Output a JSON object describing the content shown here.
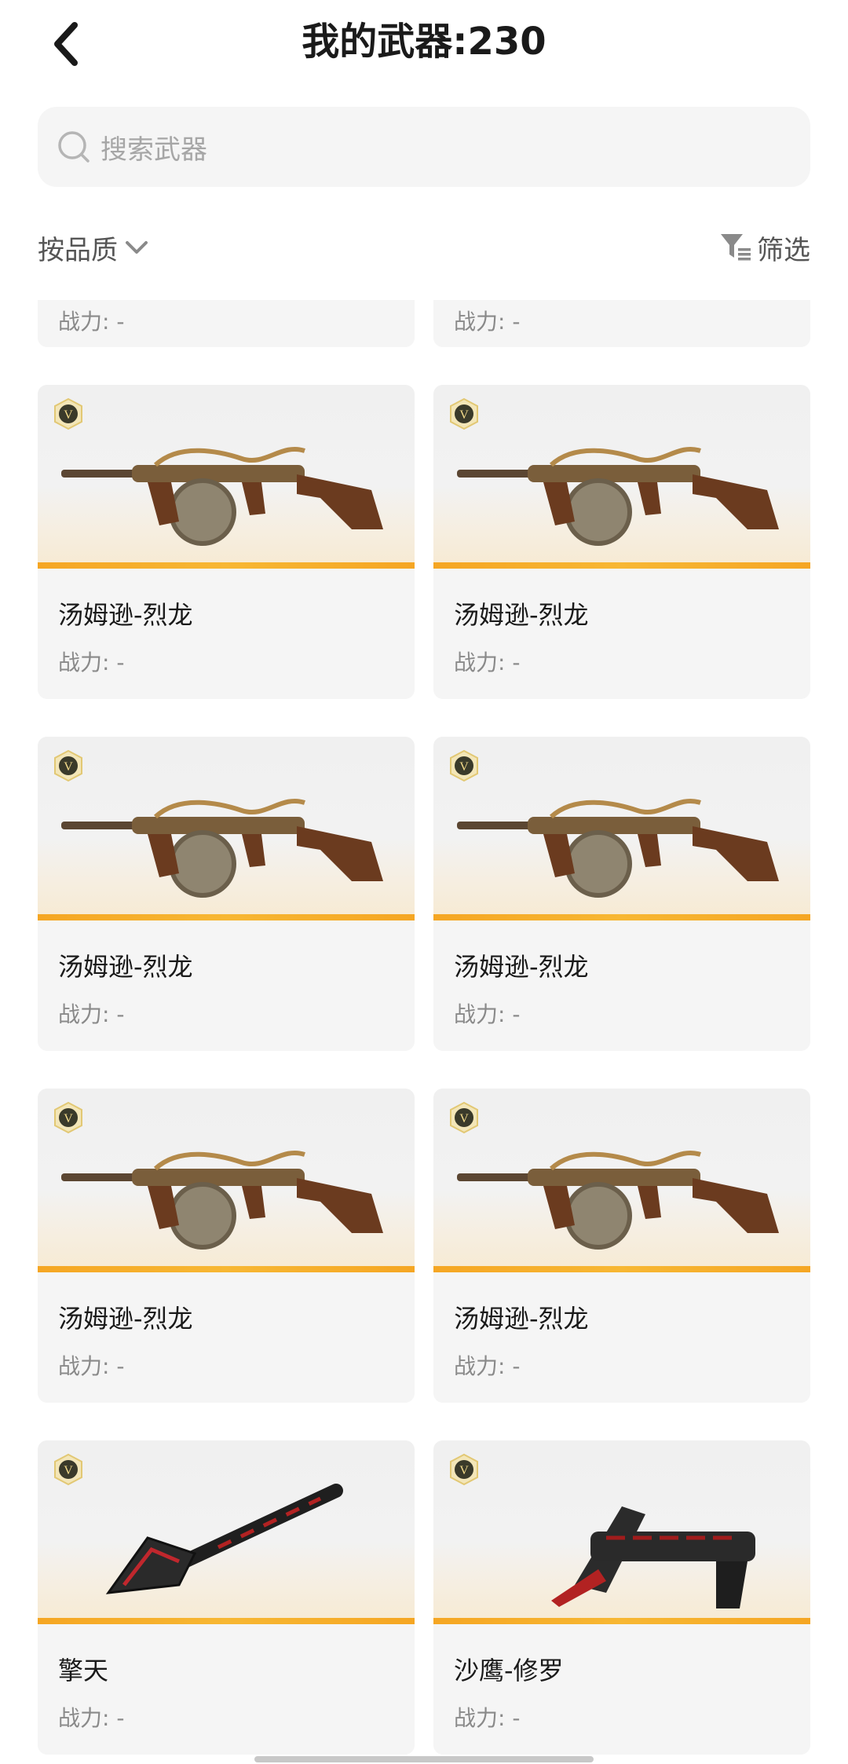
{
  "header": {
    "title": "我的武器:230"
  },
  "search": {
    "placeholder": "搜索武器"
  },
  "sort": {
    "label": "按品质"
  },
  "filter": {
    "label": "筛选"
  },
  "colors": {
    "accent": "#f5a623",
    "card_bg": "#f5f5f5",
    "muted": "#8a8a8a"
  },
  "weapons": [
    {
      "name": "",
      "power": "战力: -",
      "icon": "weapon-icon"
    },
    {
      "name": "",
      "power": "战力: -",
      "icon": "weapon-icon"
    },
    {
      "name": "汤姆逊-烈龙",
      "power": "战力: -",
      "icon": "smg-icon"
    },
    {
      "name": "汤姆逊-烈龙",
      "power": "战力: -",
      "icon": "smg-icon"
    },
    {
      "name": "汤姆逊-烈龙",
      "power": "战力: -",
      "icon": "smg-icon"
    },
    {
      "name": "汤姆逊-烈龙",
      "power": "战力: -",
      "icon": "smg-icon"
    },
    {
      "name": "汤姆逊-烈龙",
      "power": "战力: -",
      "icon": "smg-icon"
    },
    {
      "name": "汤姆逊-烈龙",
      "power": "战力: -",
      "icon": "smg-icon"
    },
    {
      "name": "擎天",
      "power": "战力: -",
      "icon": "shovel-icon"
    },
    {
      "name": "沙鹰-修罗",
      "power": "战力: -",
      "icon": "pistol-knife-icon"
    }
  ]
}
